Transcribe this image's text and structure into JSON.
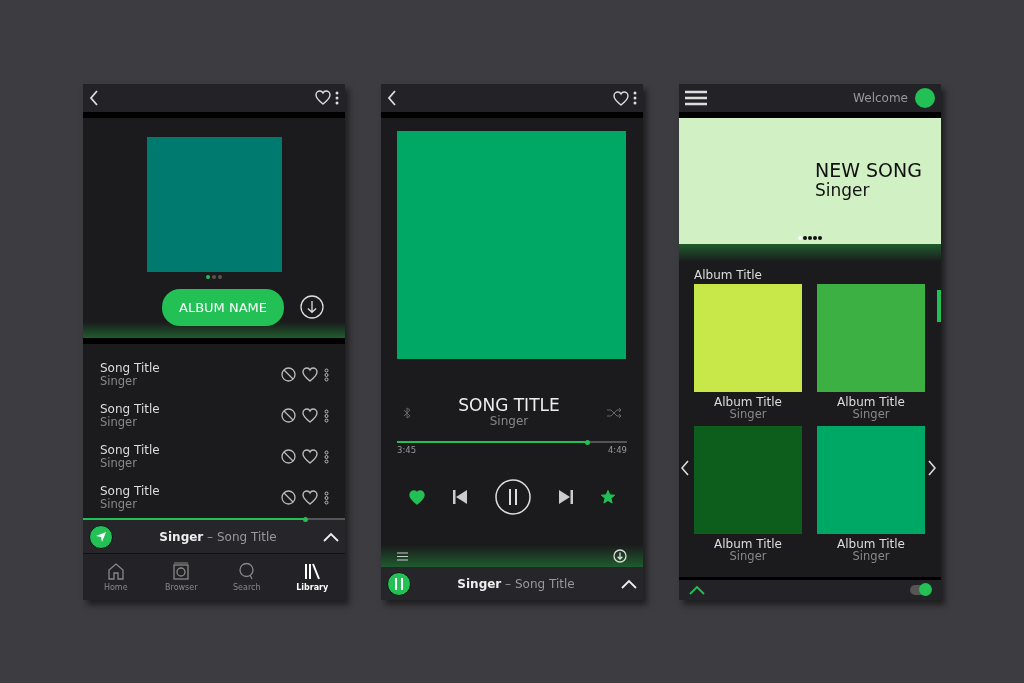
{
  "album_screen": {
    "cover_dots": [
      {
        "selected": true
      },
      {
        "selected": false
      },
      {
        "selected": false
      }
    ],
    "album_button": "ALBUM NAME",
    "songs": [
      {
        "title": "Song Title",
        "singer": "Singer"
      },
      {
        "title": "Song Title",
        "singer": "Singer"
      },
      {
        "title": "Song Title",
        "singer": "Singer"
      },
      {
        "title": "Song Title",
        "singer": "Singer"
      }
    ],
    "progress": {
      "level": 0.85
    },
    "mini_player": {
      "playing": false,
      "now_playing": "**Singer** – Song Title"
    },
    "nav": [
      {
        "label": "Home",
        "selected": false
      },
      {
        "label": "Browser",
        "selected": false
      },
      {
        "label": "Search",
        "selected": false
      },
      {
        "label": "Library",
        "selected": true
      }
    ]
  },
  "player_screen": {
    "title": "SONG TITLE",
    "singer": "Singer",
    "progress": {
      "level": 0.83
    },
    "elapsed": "3:45",
    "total": "4:49",
    "liked": true,
    "starred": true,
    "mini_player": {
      "playing": true,
      "now_playing": "**Singer** – Song Title"
    }
  },
  "home_screen": {
    "welcome": "Welcome",
    "banner": {
      "title": "NEW SONG",
      "singer": "Singer",
      "dots": [
        {
          "selected": true
        },
        {
          "selected": false
        },
        {
          "selected": false
        },
        {
          "selected": false
        },
        {
          "selected": false
        }
      ]
    },
    "section_title": "Album Title",
    "albums": [
      {
        "title": "Album Title",
        "singer": "Singer",
        "color": "#c8e84a"
      },
      {
        "title": "Album Title",
        "singer": "Singer",
        "color": "#3db044"
      },
      {
        "title": "Album Title",
        "singer": "Singer",
        "color": "#0d5e1c"
      },
      {
        "title": "Album Title",
        "singer": "Singer",
        "color": "#00a866"
      }
    ],
    "toggle": {
      "on": true
    }
  }
}
